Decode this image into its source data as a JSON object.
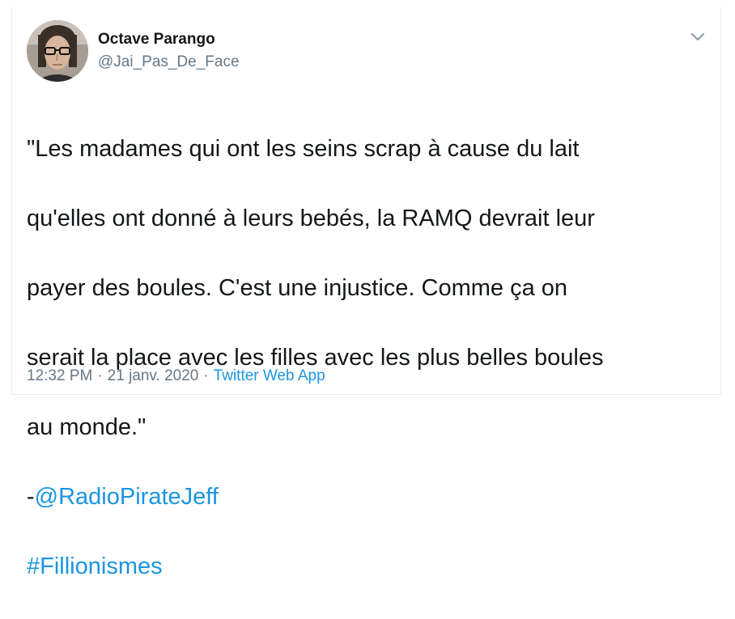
{
  "author": {
    "display_name": "Octave Parango",
    "handle": "@Jai_Pas_De_Face"
  },
  "tweet": {
    "lines": [
      "\"Les madames qui ont les seins scrap à cause du lait",
      "qu'elles ont donné à leurs bebés, la RAMQ devrait leur",
      "payer des boules. C'est une injustice. Comme ça on",
      "serait la place avec les filles avec les plus belles boules",
      "au monde.\""
    ],
    "mention_prefix": "-",
    "mention": "@RadioPirateJeff",
    "hashtag": "#Fillionismes"
  },
  "meta": {
    "time": "12:32 PM",
    "separator": "·",
    "date": "21 janv. 2020",
    "source": "Twitter Web App"
  },
  "icons": {
    "caret": "chevron-down-icon"
  },
  "colors": {
    "link": "#1b95e0",
    "secondary_text": "#657786",
    "primary_text": "#14171a"
  }
}
